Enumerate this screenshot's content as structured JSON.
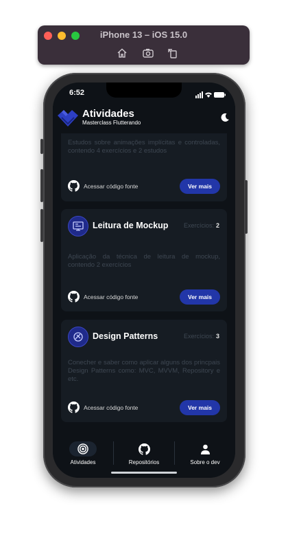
{
  "simulator": {
    "title": "iPhone 13 – iOS 15.0",
    "tools": [
      "home-icon",
      "screenshot-icon",
      "rotate-icon"
    ]
  },
  "status": {
    "time": "6:52"
  },
  "header": {
    "title": "Atividades",
    "subtitle": "Masterclass Flutterando",
    "theme_icon": "moon-icon"
  },
  "cards": [
    {
      "description": "Estudos sobre animações implícitas e controladas, contendo 4 exercícios e 2 estudos",
      "source_label": "Acessar código fonte",
      "more_label": "Ver mais"
    },
    {
      "title": "Leitura de Mockup",
      "count_label": "Exercícios:",
      "count": "2",
      "description": "Aplicação da técnica de leitura de mockup, contendo 2 exercícios",
      "source_label": "Acessar código fonte",
      "more_label": "Ver mais"
    },
    {
      "title": "Design Patterns",
      "count_label": "Exercícios:",
      "count": "3",
      "description": "Conecher e saber como aplicar alguns dos princpais Design Patterns como: MVC, MVVM, Repository e etc.",
      "source_label": "Acessar código fonte",
      "more_label": "Ver mais"
    }
  ],
  "nav": {
    "items": [
      {
        "label": "Atividades",
        "icon": "target-icon",
        "active": true
      },
      {
        "label": "Repositórios",
        "icon": "github-icon",
        "active": false
      },
      {
        "label": "Sobre o dev",
        "icon": "person-icon",
        "active": false
      }
    ]
  },
  "colors": {
    "background": "#0e1217",
    "card": "#161c23",
    "accent": "#2236a8"
  }
}
